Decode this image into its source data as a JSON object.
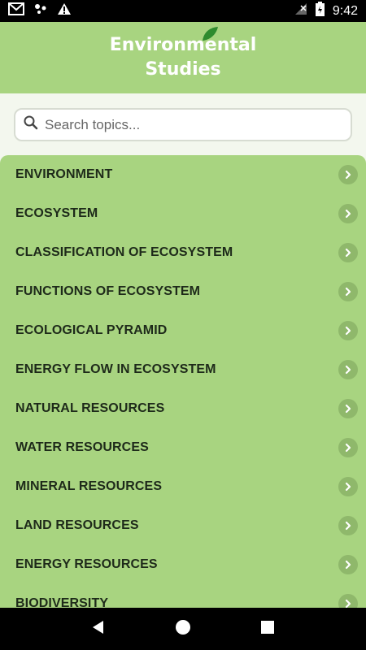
{
  "status_bar": {
    "time": "9:42",
    "left_icons": [
      "gmail-icon",
      "dots-icon",
      "warning-icon"
    ],
    "right_icons": [
      "signal-off-icon",
      "battery-icon"
    ]
  },
  "header": {
    "title_line1": "Environmental",
    "title_line2": "Studies",
    "bg_color": "#a8d480"
  },
  "search": {
    "placeholder": "Search topics..."
  },
  "topics": [
    "ENVIRONMENT",
    "ECOSYSTEM",
    "CLASSIFICATION OF ECOSYSTEM",
    "FUNCTIONS OF ECOSYSTEM",
    "ECOLOGICAL PYRAMID",
    "ENERGY FLOW IN ECOSYSTEM",
    "NATURAL RESOURCES",
    "WATER RESOURCES",
    "MINERAL RESOURCES",
    "LAND RESOURCES",
    "ENERGY RESOURCES",
    "BIODIVERSITY"
  ],
  "nav": {
    "icons": [
      "back-icon",
      "home-icon",
      "recents-icon"
    ]
  }
}
